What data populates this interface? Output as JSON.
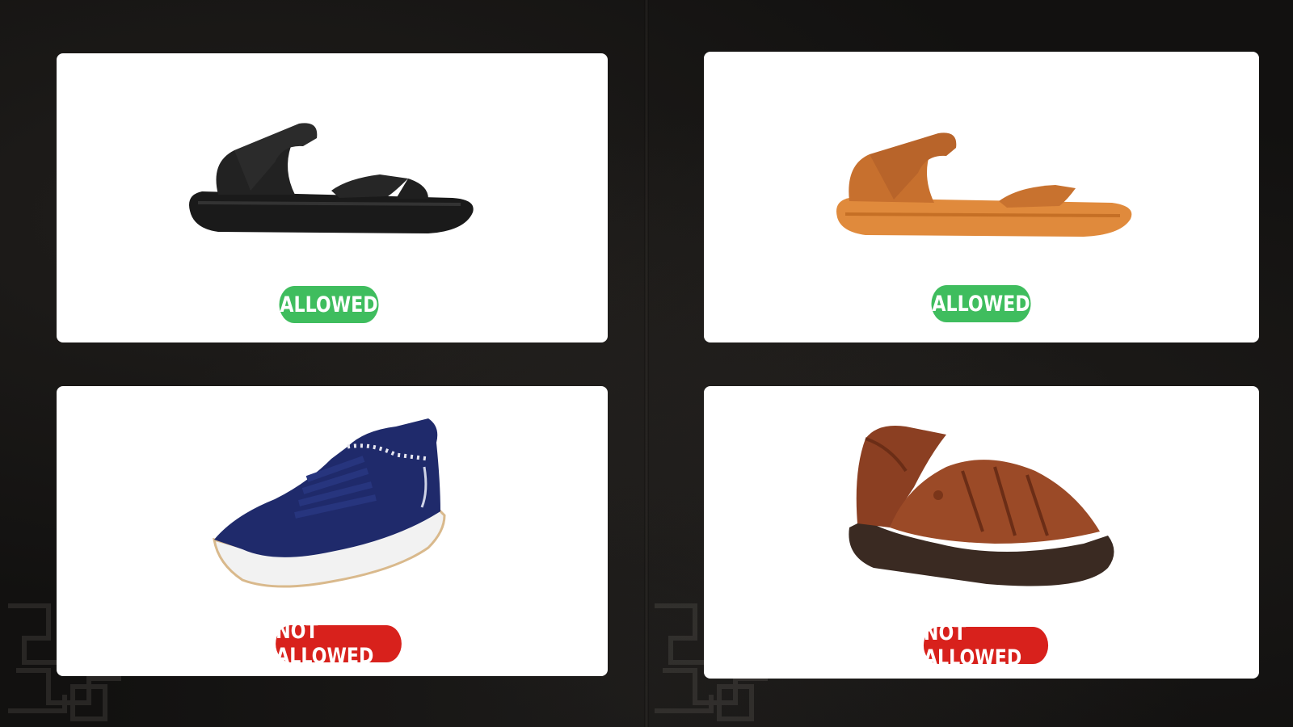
{
  "colors": {
    "background": "#121110",
    "card": "#ffffff",
    "allowed": "#3fbd5e",
    "not_allowed": "#d8211c"
  },
  "cards": [
    {
      "item": "black-velcro-sandal-icon",
      "status": "ALLOWED"
    },
    {
      "item": "tan-velcro-sandal-icon",
      "status": "ALLOWED"
    },
    {
      "item": "navy-sneaker-icon",
      "status": "NOT ALLOWED"
    },
    {
      "item": "brown-fisherman-sandal-icon",
      "status": "NOT ALLOWED"
    }
  ]
}
